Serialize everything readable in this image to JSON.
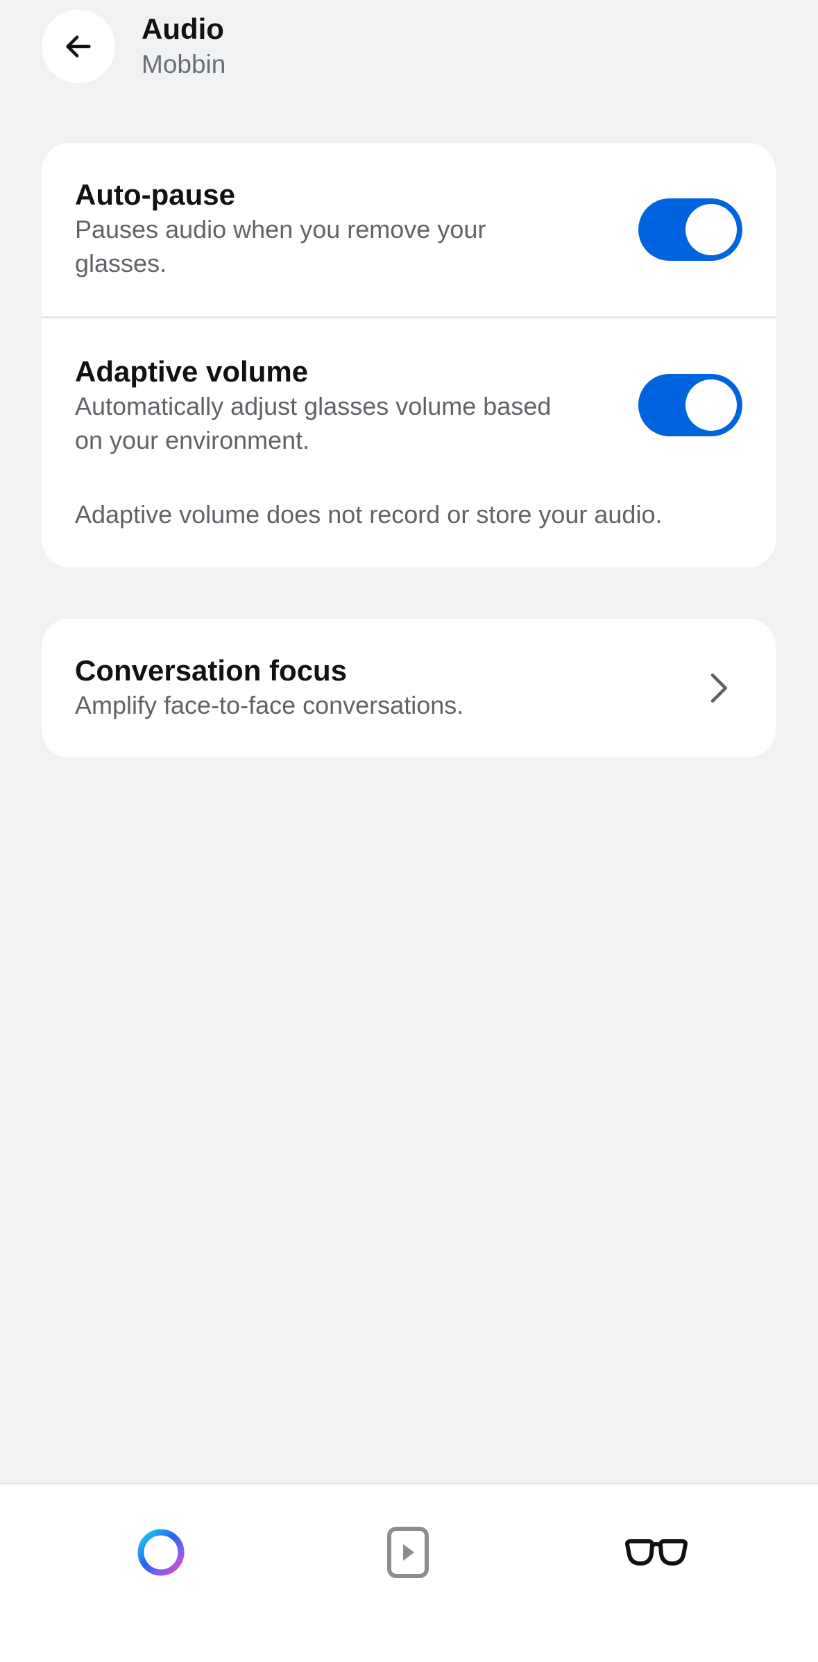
{
  "header": {
    "title": "Audio",
    "subtitle": "Mobbin"
  },
  "audio_settings": {
    "auto_pause": {
      "title": "Auto-pause",
      "description": "Pauses audio when you remove your glasses.",
      "enabled": true
    },
    "adaptive_volume": {
      "title": "Adaptive volume",
      "description": "Automatically adjust glasses volume based on your environment.",
      "enabled": true,
      "note": "Adaptive volume does not record or store your audio."
    }
  },
  "conversation_focus": {
    "title": "Conversation focus",
    "description": "Amplify face-to-face conversations."
  },
  "bottom_nav": {
    "items": [
      {
        "icon": "meta-ai-ring-icon"
      },
      {
        "icon": "media-play-icon"
      },
      {
        "icon": "glasses-icon"
      }
    ]
  },
  "colors": {
    "accent": "#0064e0",
    "background": "#f1f2f4",
    "card": "#ffffff"
  }
}
